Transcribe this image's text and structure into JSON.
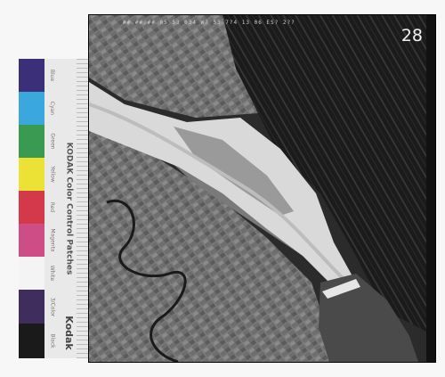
{
  "frame_number": "28",
  "header_text": "##.##.## 05 53 034 W? 53 7?4 13 06 ES? 2??",
  "control_strip": {
    "title": "KODAK Color Control Patches",
    "brand": "Kodak",
    "patches": [
      {
        "label": "Blue",
        "color": "#3a2f78"
      },
      {
        "label": "Cyan",
        "color": "#3aa8dd"
      },
      {
        "label": "Green",
        "color": "#3a9a52"
      },
      {
        "label": "Yellow",
        "color": "#ece236"
      },
      {
        "label": "Red",
        "color": "#d4394a"
      },
      {
        "label": "Magenta",
        "color": "#cf4d86"
      },
      {
        "label": "White",
        "color": "#f4f4f4"
      },
      {
        "label": "3/Color",
        "color": "#3f2d5e"
      },
      {
        "label": "Black",
        "color": "#1a1a1a"
      }
    ]
  }
}
